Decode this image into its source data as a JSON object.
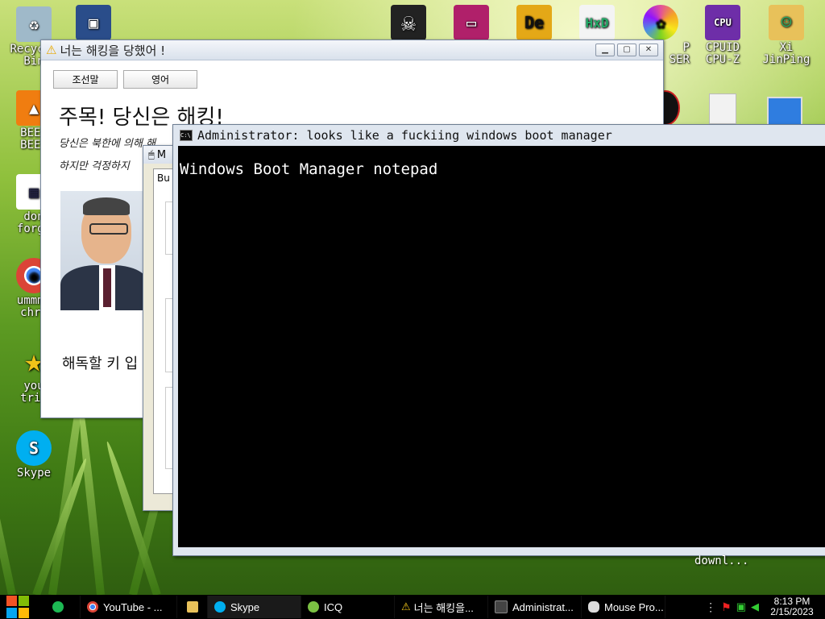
{
  "desktop": {
    "icons": [
      {
        "label": "Recycle\nBin",
        "icon": "recycle-bin-icon",
        "color": "#9fb9c9",
        "glyph": "♻"
      },
      {
        "label": "",
        "icon": "virtualbox-icon",
        "color": "#2a4d8a",
        "glyph": "▣"
      },
      {
        "label": "",
        "icon": "skull-icon",
        "color": "#222",
        "glyph": "☠"
      },
      {
        "label": "",
        "icon": "monitor-icon",
        "color": "#b0206a",
        "glyph": "▭"
      },
      {
        "label": "",
        "icon": "de-icon",
        "color": "#e4a817",
        "glyph": "De"
      },
      {
        "label": "",
        "icon": "hxd-icon",
        "color": "#f4f4f4",
        "glyph": "HxD"
      },
      {
        "label": "P\nSER",
        "icon": "color-wheel-icon",
        "color": "#e24f9c",
        "glyph": "✿"
      },
      {
        "label": "CPUID\nCPU-Z",
        "icon": "cpuz-icon",
        "color": "#6e2ea8",
        "glyph": "CPU"
      },
      {
        "label": "Xi\nJinPing",
        "icon": "user-folder-icon",
        "color": "#e8c15a",
        "glyph": "👤"
      },
      {
        "label": "BEEP\nBEEP",
        "icon": "vlc-icon",
        "color": "#f07d10",
        "glyph": "▲"
      },
      {
        "label": "don\nforge",
        "icon": "calendar-icon",
        "color": "#ffffff",
        "glyph": "▦"
      },
      {
        "label": "ummmm\nchro",
        "icon": "chrome-icon",
        "color": "#db4437",
        "glyph": "◉"
      },
      {
        "label": "you\ntrie",
        "icon": "star-icon",
        "color": "#f0c419",
        "glyph": "★"
      },
      {
        "label": "Skype",
        "icon": "skype-icon",
        "color": "#00aff0",
        "glyph": "S"
      }
    ]
  },
  "ransom_window": {
    "title": "너는 해킹을 당했어 !",
    "lang_btn_1": "조선말",
    "lang_btn_2": "영어",
    "heading": "주목! 당신은 해킹!",
    "line1": "당신은 북한에 의해 해",
    "line2": "하지만 걱정하지",
    "key_prompt": "해독할 키 입"
  },
  "mid_window": {
    "title_fragment": "M",
    "tab_fragment": "Bu"
  },
  "cmd_window": {
    "title": "Administrator:  looks like a fuckiing windows boot manager",
    "body": "Windows Boot Manager  notepad"
  },
  "desktop_label_download": "downl...",
  "taskbar": {
    "items": [
      {
        "label": "",
        "icon": "chat-icon",
        "color": "#1db954"
      },
      {
        "label": "YouTube - ...",
        "icon": "chrome-icon",
        "color": "#db4437"
      },
      {
        "label": "",
        "icon": "folder-icon",
        "color": "#e8c15a"
      },
      {
        "label": "Skype",
        "icon": "skype-icon",
        "color": "#00aff0"
      },
      {
        "label": "ICQ",
        "icon": "icq-icon",
        "color": "#7bc043"
      },
      {
        "label": "너는 해킹을...",
        "icon": "warning-icon",
        "color": "#f0c419"
      },
      {
        "label": "Administrat...",
        "icon": "cmd-icon",
        "color": "#444"
      },
      {
        "label": "Mouse Pro...",
        "icon": "mouse-icon",
        "color": "#ddd"
      }
    ],
    "time": "8:13 PM",
    "date": "2/15/2023"
  }
}
